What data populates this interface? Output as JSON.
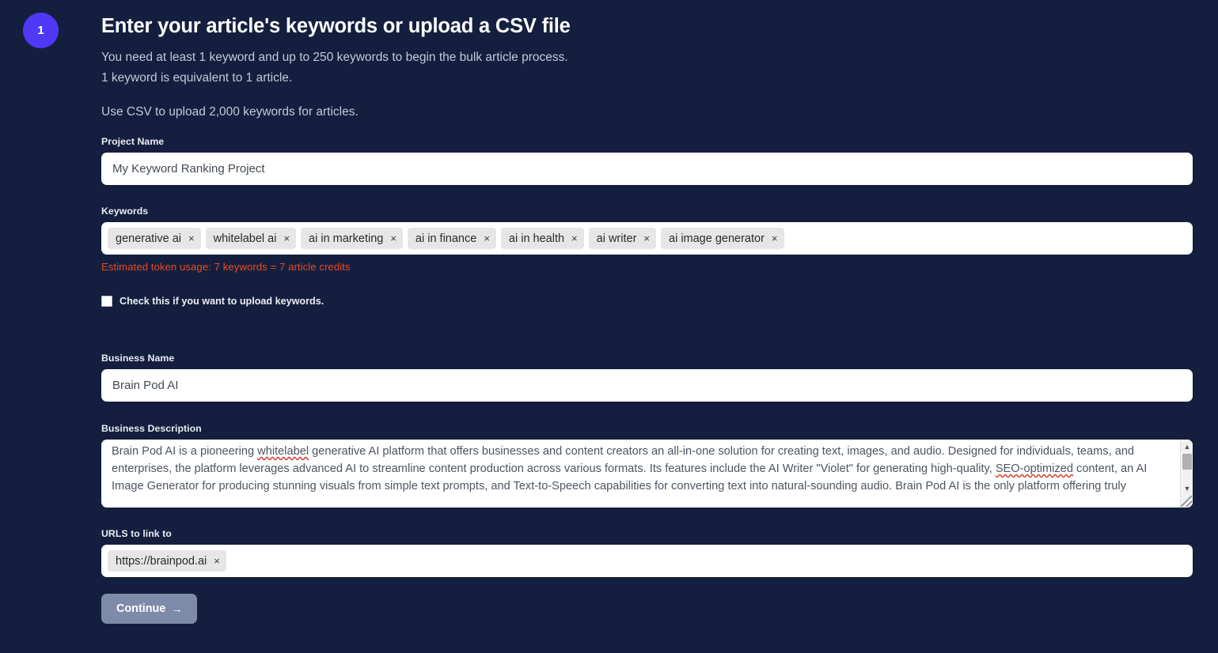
{
  "step": {
    "number": "1"
  },
  "header": {
    "title": "Enter your article's keywords or upload a CSV file",
    "line1": "You need at least 1 keyword and up to 250 keywords to begin the bulk article process.",
    "line2": "1 keyword is equivalent to 1 article.",
    "line3": "Use CSV to upload 2,000 keywords for articles."
  },
  "project": {
    "label": "Project Name",
    "value": "My Keyword Ranking Project"
  },
  "keywords": {
    "label": "Keywords",
    "chips": [
      "generative ai",
      "whitelabel ai",
      "ai in marketing",
      "ai in finance",
      "ai in health",
      "ai writer",
      "ai image generator"
    ],
    "remove_glyph": "×",
    "token_note": "Estimated token usage: 7 keywords = 7 article credits"
  },
  "upload_toggle": {
    "label": "Check this if you want to upload keywords.",
    "checked": false
  },
  "business_name": {
    "label": "Business Name",
    "value": "Brain Pod AI"
  },
  "business_description": {
    "label": "Business Description",
    "part1": "Brain Pod AI is a pioneering ",
    "misspell1": "whitelabel",
    "part2": " generative AI platform that offers businesses and content creators an all-in-one solution for creating text, images, and audio. Designed for individuals, teams, and enterprises, the platform leverages advanced AI to streamline content production across various formats. Its features include the AI Writer \"Violet\" for generating high-quality, ",
    "misspell2": "SEO-optimized",
    "part3": " content, an AI Image Generator for producing stunning visuals from simple text prompts, and Text-to-Speech capabilities for converting text into natural-sounding audio. Brain Pod AI is the only platform offering truly"
  },
  "urls": {
    "label": "URLS to link to",
    "chips": [
      "https://brainpod.ai"
    ],
    "remove_glyph": "×"
  },
  "continue": {
    "label": "Continue",
    "arrow": "→"
  },
  "colors": {
    "background": "#141f3f",
    "accent": "#4f39f6",
    "warning": "#e8491f",
    "button": "#7d8aa8"
  }
}
